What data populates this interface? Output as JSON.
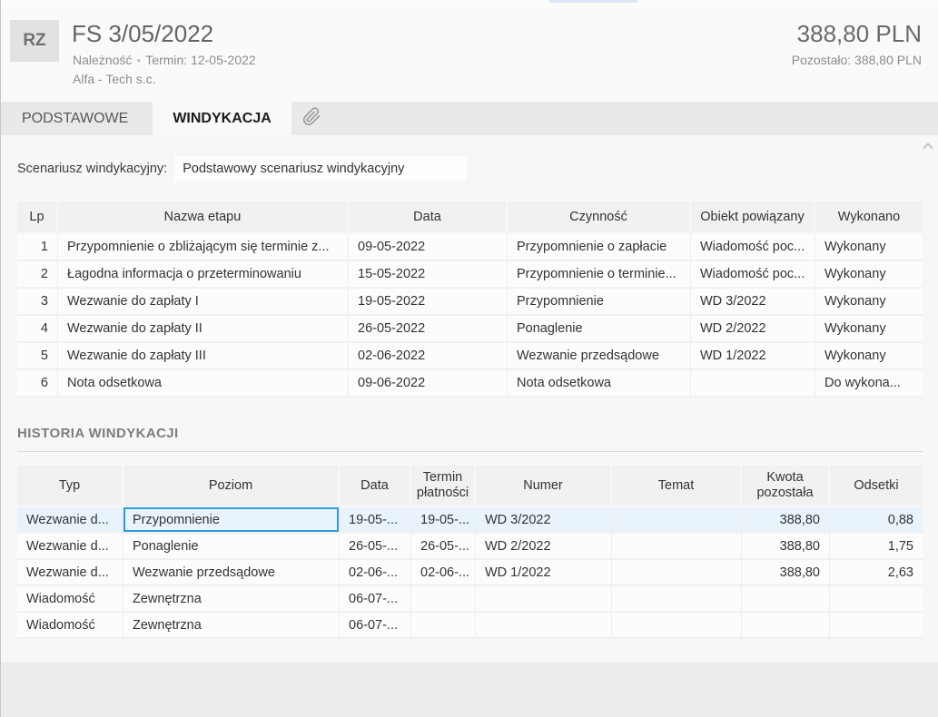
{
  "header": {
    "avatar": "RZ",
    "title": "FS 3/05/2022",
    "type_label": "Należność",
    "separator": "•",
    "term": "Termin: 12-05-2022",
    "company": "Alfa - Tech s.c.",
    "amount": "388,80 PLN",
    "remaining": "Pozostało: 388,80 PLN"
  },
  "tabs": {
    "basic": "PODSTAWOWE",
    "collection": "WINDYKACJA"
  },
  "scenario": {
    "label": "Scenariusz windykacyjny:",
    "value": "Podstawowy scenariusz windykacyjny"
  },
  "stages_table": {
    "columns": [
      "Lp",
      "Nazwa etapu",
      "Data",
      "Czynność",
      "Obiekt powiązany",
      "Wykonano"
    ],
    "rows": [
      [
        "1",
        "Przypomnienie o zbliżającym się terminie z...",
        "09-05-2022",
        "Przypomnienie o zapłacie",
        "Wiadomość poc...",
        "Wykonany"
      ],
      [
        "2",
        "Łagodna informacja o przeterminowaniu",
        "15-05-2022",
        "Przypomnienie o terminie...",
        "Wiadomość poc...",
        "Wykonany"
      ],
      [
        "3",
        "Wezwanie do zapłaty I",
        "19-05-2022",
        "Przypomnienie",
        "WD 3/2022",
        "Wykonany"
      ],
      [
        "4",
        "Wezwanie do zapłaty II",
        "26-05-2022",
        "Ponaglenie",
        "WD 2/2022",
        "Wykonany"
      ],
      [
        "5",
        "Wezwanie do zapłaty III",
        "02-06-2022",
        "Wezwanie przedsądowe",
        "WD 1/2022",
        "Wykonany"
      ],
      [
        "6",
        "Nota odsetkowa",
        "09-06-2022",
        "Nota odsetkowa",
        "",
        "Do wykona..."
      ]
    ]
  },
  "history_section": {
    "title": "HISTORIA WINDYKACJI",
    "columns": [
      "Typ",
      "Poziom",
      "Data",
      "Termin płatności",
      "Numer",
      "Temat",
      "Kwota pozostała",
      "Odsetki"
    ],
    "rows": [
      [
        "Wezwanie d...",
        "Przypomnienie",
        "19-05-...",
        "19-05-...",
        "WD 3/2022",
        "",
        "388,80",
        "0,88"
      ],
      [
        "Wezwanie d...",
        "Ponaglenie",
        "26-05-...",
        "26-05-...",
        "WD 2/2022",
        "",
        "388,80",
        "1,75"
      ],
      [
        "Wezwanie d...",
        "Wezwanie przedsądowe",
        "02-06-...",
        "02-06-...",
        "WD 1/2022",
        "",
        "388,80",
        "2,63"
      ],
      [
        "Wiadomość",
        "Zewnętrzna",
        "06-07-...",
        "",
        "",
        "",
        "",
        ""
      ],
      [
        "Wiadomość",
        "Zewnętrzna",
        "06-07-...",
        "",
        "",
        "",
        "",
        ""
      ]
    ],
    "selected": {
      "row": 0,
      "cell": 1
    }
  },
  "colors": {
    "accent_selection": "#2e9bd6",
    "selected_row_bg": "#e9f3fb",
    "tabbar_bg": "#e9e9e9",
    "header_cell_bg": "#f1f1f1"
  }
}
